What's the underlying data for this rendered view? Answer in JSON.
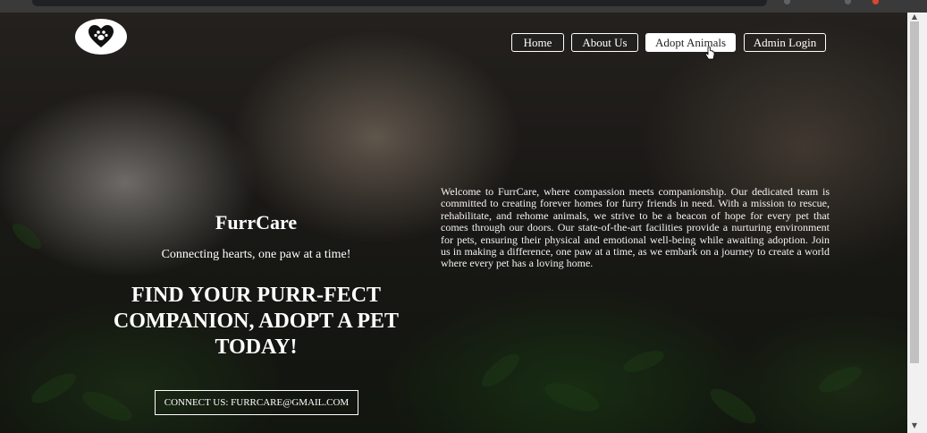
{
  "brand": {
    "logo_icon": "heart-paw-icon",
    "name": "FurrCare",
    "tagline": "Connecting hearts, one paw at a time!"
  },
  "nav": {
    "items": [
      {
        "label": "Home"
      },
      {
        "label": "About Us"
      },
      {
        "label": "Adopt Animals",
        "active": true
      },
      {
        "label": "Admin Login"
      }
    ]
  },
  "hero": {
    "headline": "FIND YOUR PURR-FECT COMPANION, ADOPT A PET TODAY!",
    "contact_button": "CONNECT US: FURRCARE@GMAIL.COM",
    "about_text": "Welcome to FurrCare, where compassion meets companionship. Our dedicated team is committed to creating forever homes for furry friends in need. With a mission to rescue, rehabilitate, and rehome animals, we strive to be a beacon of hope for every pet that comes through our doors. Our state-of-the-art facilities provide a nurturing environment for pets, ensuring their physical and emotional well-being while awaiting adoption. Join us in making a difference, one paw at a time, as we embark on a journey to create a world where every pet has a loving home."
  },
  "colors": {
    "text": "#ffffff",
    "active_nav_bg": "#ffffff",
    "active_nav_text": "#222222"
  }
}
